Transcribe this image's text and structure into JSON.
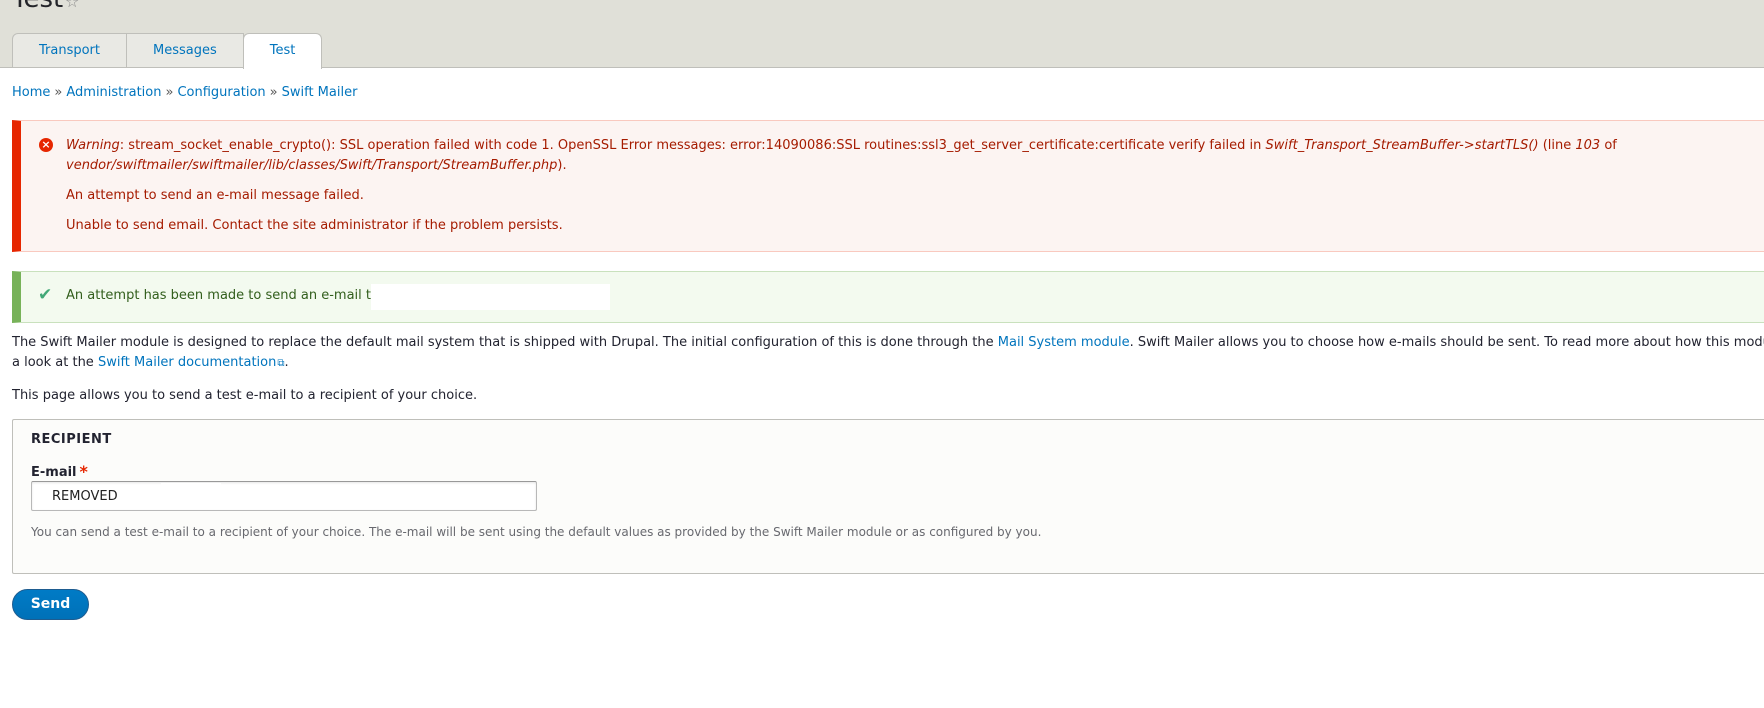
{
  "header": {
    "title": "Test",
    "tabs": [
      {
        "label": "Transport"
      },
      {
        "label": "Messages"
      },
      {
        "label": "Test"
      }
    ]
  },
  "breadcrumb": {
    "items": [
      "Home",
      "Administration",
      "Configuration",
      "Swift Mailer"
    ],
    "separator": "»"
  },
  "error": {
    "warning_label": "Warning",
    "line1_text": ": stream_socket_enable_crypto(): SSL operation failed with code 1. OpenSSL Error messages: error:14090086:SSL routines:ssl3_get_server_certificate:certificate verify failed in ",
    "line1_function": "Swift_Transport_StreamBuffer->startTLS()",
    "line1_line_prefix": " (line ",
    "line1_line_number": "103",
    "line1_of": " of",
    "line2_file": "vendor/swiftmailer/swiftmailer/lib/classes/Swift/Transport/StreamBuffer.php",
    "line2_end": ").",
    "message2": "An attempt to send an e-mail message failed.",
    "message3": "Unable to send email. Contact the site administrator if the problem persists."
  },
  "status": {
    "message": "An attempt has been made to send an e-mail to"
  },
  "intro": {
    "p1_a": "The Swift Mailer module is designed to replace the default mail system that is shipped with Drupal. The initial configuration of this is done through the ",
    "p1_link": "Mail System module",
    "p1_b": ". Swift Mailer allows you to choose how e-mails should be sent. To read more about how this module wor",
    "p1_c": "a look at the ",
    "p1_link2": "Swift Mailer documentation",
    "p1_d": ".",
    "p2": "This page allows you to send a test e-mail to a recipient of your choice."
  },
  "form": {
    "legend": "RECIPIENT",
    "email_label": "E-mail",
    "required_mark": "*",
    "email_value": "REMOVED",
    "description": "You can send a test e-mail to a recipient of your choice. The e-mail will be sent using the default values as provided by the Swift Mailer module or as configured by you.",
    "submit_label": "Send"
  },
  "colors": {
    "link": "#0074bd",
    "error_border": "#e62600",
    "status_border": "#77b259",
    "button": "#0071b8"
  }
}
